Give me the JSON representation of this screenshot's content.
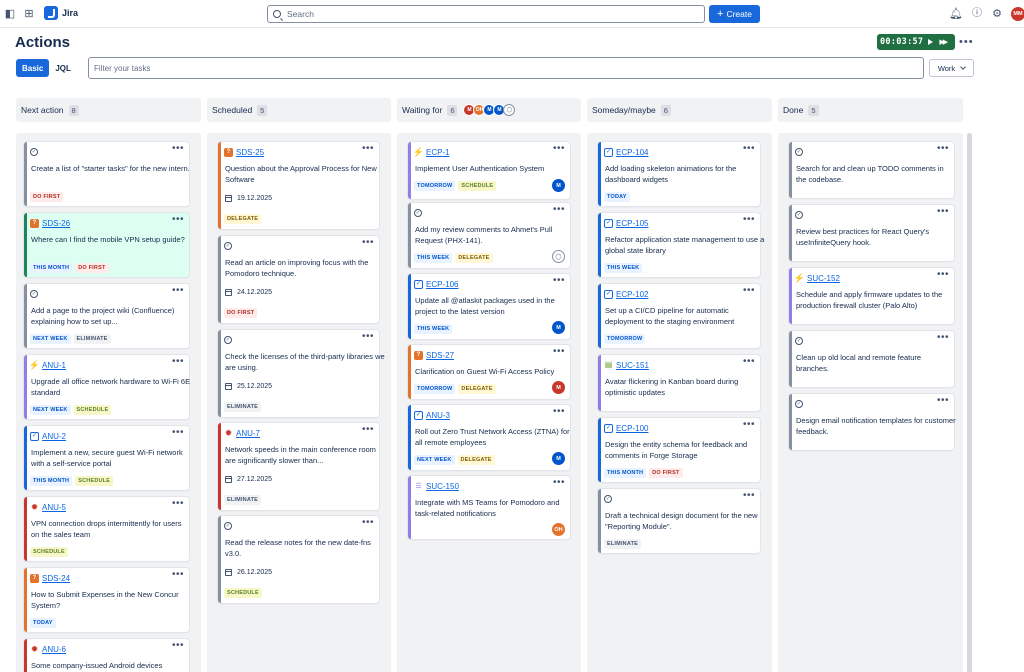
{
  "header": {
    "app_name": "Jira",
    "search_placeholder": "Search",
    "create_label": "Create",
    "user_initials": "MM"
  },
  "page": {
    "title": "Actions",
    "timer": "00:03:57",
    "view_basic": "Basic",
    "view_jql": "JQL",
    "filter_placeholder": "Filter your tasks",
    "work_select": "Work"
  },
  "columns": [
    {
      "name": "Next action",
      "count": "8"
    },
    {
      "name": "Scheduled",
      "count": "5"
    },
    {
      "name": "Waiting for",
      "count": "6",
      "avatars": [
        "M",
        "OH",
        "M",
        "M",
        ""
      ]
    },
    {
      "name": "Someday/maybe",
      "count": "6"
    },
    {
      "name": "Done",
      "count": "5"
    }
  ],
  "cards": {
    "next": [
      {
        "text": "Create a list of \"starter tasks\" for the new intern.",
        "tags": [
          "DO FIRST"
        ]
      },
      {
        "key": "SDS-26",
        "text": "Where can I find the mobile VPN setup guide?",
        "tags": [
          "THIS MONTH",
          "DO FIRST"
        ]
      },
      {
        "text": "Add a page to the project wiki (Confluence) explaining how to set up...",
        "tags": [
          "NEXT WEEK",
          "ELIMINATE"
        ]
      },
      {
        "key": "ANU-1",
        "text": "Upgrade all office network hardware to Wi-Fi 6E standard",
        "tags": [
          "NEXT WEEK",
          "SCHEDULE"
        ]
      },
      {
        "key": "ANU-2",
        "text": "Implement a new, secure guest Wi-Fi network with a self-service portal",
        "tags": [
          "THIS MONTH",
          "SCHEDULE"
        ]
      },
      {
        "key": "ANU-5",
        "text": "VPN connection drops intermittently for users on the sales team",
        "tags": [
          "SCHEDULE"
        ]
      },
      {
        "key": "SDS-24",
        "text": "How to Submit Expenses in the New Concur System?",
        "tags": [
          "TODAY"
        ]
      },
      {
        "key": "ANU-6",
        "text": "Some company-issued Android devices"
      }
    ],
    "scheduled": [
      {
        "key": "SDS-25",
        "text": "Question about the Approval Process for New Software",
        "date": "19.12.2025",
        "tags": [
          "DELEGATE"
        ]
      },
      {
        "text": "Read an article on improving focus with the Pomodoro technique.",
        "date": "24.12.2025",
        "tags": [
          "DO FIRST"
        ]
      },
      {
        "text": "Check the licenses of the third-party libraries we are using.",
        "date": "25.12.2025",
        "tags": [
          "ELIMINATE"
        ]
      },
      {
        "key": "ANU-7",
        "text": "Network speeds in the main conference room are significantly slower than...",
        "date": "27.12.2025",
        "tags": [
          "ELIMINATE"
        ]
      },
      {
        "text": "Read the release notes for the new date-fns v3.0.",
        "date": "26.12.2025",
        "tags": [
          "SCHEDULE"
        ]
      }
    ],
    "waiting": [
      {
        "key": "ECP-1",
        "text": "Implement User Authentication System",
        "tags": [
          "TOMORROW",
          "SCHEDULE"
        ],
        "assignee": "M"
      },
      {
        "text": "Add my review comments to Ahmet's Pull Request (PHX-141).",
        "tags": [
          "THIS WEEK",
          "DELEGATE"
        ],
        "assignee": ""
      },
      {
        "key": "ECP-106",
        "text": "Update all @atlaskit packages used in the project to the latest version",
        "tags": [
          "THIS WEEK"
        ],
        "assignee": "M"
      },
      {
        "key": "SDS-27",
        "text": "Clarification on Guest Wi-Fi Access Policy",
        "tags": [
          "TOMORROW",
          "DELEGATE"
        ],
        "assignee": "M"
      },
      {
        "key": "ANU-3",
        "text": "Roll out Zero Trust Network Access (ZTNA) for all remote employees",
        "tags": [
          "NEXT WEEK",
          "DELEGATE"
        ],
        "assignee": "M"
      },
      {
        "key": "SUC-150",
        "text": "Integrate with MS Teams for Pomodoro and task-related notifications",
        "assignee": "OH"
      }
    ],
    "someday": [
      {
        "key": "ECP-104",
        "text": "Add loading skeleton animations for the dashboard widgets",
        "tags": [
          "TODAY"
        ]
      },
      {
        "key": "ECP-105",
        "text": "Refactor application state management to use a global state library",
        "tags": [
          "THIS WEEK"
        ]
      },
      {
        "key": "ECP-102",
        "text": "Set up a CI/CD pipeline for automatic deployment to the staging environment",
        "tags": [
          "TOMORROW"
        ]
      },
      {
        "key": "SUC-151",
        "text": "Avatar flickering in Kanban board during optimistic updates"
      },
      {
        "key": "ECP-100",
        "text": "Design the entity schema for feedback and comments in Forge Storage",
        "tags": [
          "THIS MONTH",
          "DO FIRST"
        ]
      },
      {
        "text": "Draft a technical design document for the new \"Reporting Module\".",
        "tags": [
          "ELIMINATE"
        ]
      }
    ],
    "done": [
      {
        "text": "Search for and clean up TODO comments in the codebase."
      },
      {
        "text": "Review best practices for React Query's useInfiniteQuery hook."
      },
      {
        "key": "SUC-152",
        "text": "Schedule and apply firmware updates to the production firewall cluster (Palo Alto)"
      },
      {
        "text": "Clean up old local and remote feature branches."
      },
      {
        "text": "Design email notification templates for customer feedback."
      }
    ]
  },
  "colors": {
    "brand": "#1868db",
    "timer_bg": "#1f6f43",
    "avatar_blue": "#0055cc",
    "avatar_red": "#c9372c",
    "avatar_orange": "#e2722c"
  }
}
